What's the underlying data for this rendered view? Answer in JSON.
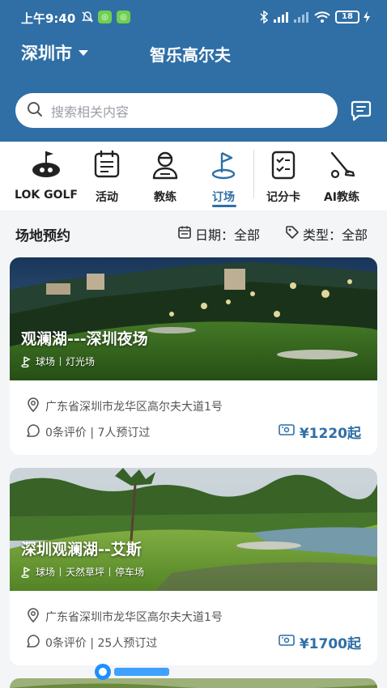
{
  "status_bar": {
    "time": "上午9:40",
    "battery": "18"
  },
  "header": {
    "city": "深圳市",
    "app_title": "智乐高尔夫"
  },
  "search": {
    "placeholder": "搜索相关内容"
  },
  "nav": {
    "items": [
      {
        "label": "LOK GOLF",
        "icon": "golf-logo-icon"
      },
      {
        "label": "活动",
        "icon": "calendar-icon"
      },
      {
        "label": "教练",
        "icon": "coach-icon"
      },
      {
        "label": "订场",
        "icon": "flag-icon",
        "active": true
      },
      {
        "label": "记分卡",
        "icon": "scorecard-icon"
      },
      {
        "label": "AI教练",
        "icon": "golf-club-icon"
      }
    ]
  },
  "section": {
    "title": "场地预约",
    "date_filter": "日期：全部",
    "type_filter": "类型：全部"
  },
  "venues": [
    {
      "name": "观澜湖---深圳夜场",
      "tags": [
        "球场",
        "灯光场"
      ],
      "address": "广东省深圳市龙华区高尔夫大道1号",
      "stats": "0条评价 | 7人预订过",
      "price": "¥1220起"
    },
    {
      "name": "深圳观澜湖--艾斯",
      "tags": [
        "球场",
        "天然草坪",
        "停车场"
      ],
      "address": "广东省深圳市龙华区高尔夫大道1号",
      "stats": "0条评价 | 25人预订过",
      "price": "¥1700起"
    }
  ],
  "colors": {
    "primary": "#2f6fa6",
    "background": "#f4f5f7"
  }
}
